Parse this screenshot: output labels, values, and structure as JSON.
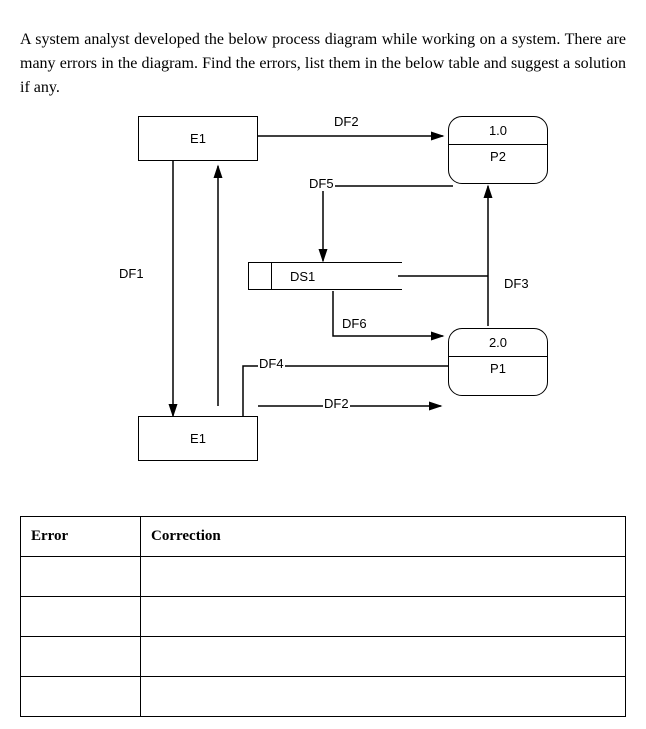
{
  "intro": "A system analyst developed the below process diagram while working on a system. There are many errors in the diagram. Find the errors, list them in the below table and suggest a solution if any.",
  "diagram": {
    "entities": {
      "e1_top": "E1",
      "e1_bottom": "E1"
    },
    "processes": {
      "p1": {
        "id": "1.0",
        "name": "P2"
      },
      "p2": {
        "id": "2.0",
        "name": "P1"
      }
    },
    "datastore": {
      "ds1": "DS1"
    },
    "flows": {
      "df1": "DF1",
      "df2_top": "DF2",
      "df2_bottom": "DF2",
      "df3": "DF3",
      "df4": "DF4",
      "df5": "DF5",
      "df6": "DF6"
    }
  },
  "table": {
    "headers": {
      "error": "Error",
      "correction": "Correction"
    },
    "rows": [
      {
        "error": "",
        "correction": ""
      },
      {
        "error": "",
        "correction": ""
      },
      {
        "error": "",
        "correction": ""
      },
      {
        "error": "",
        "correction": ""
      }
    ]
  }
}
